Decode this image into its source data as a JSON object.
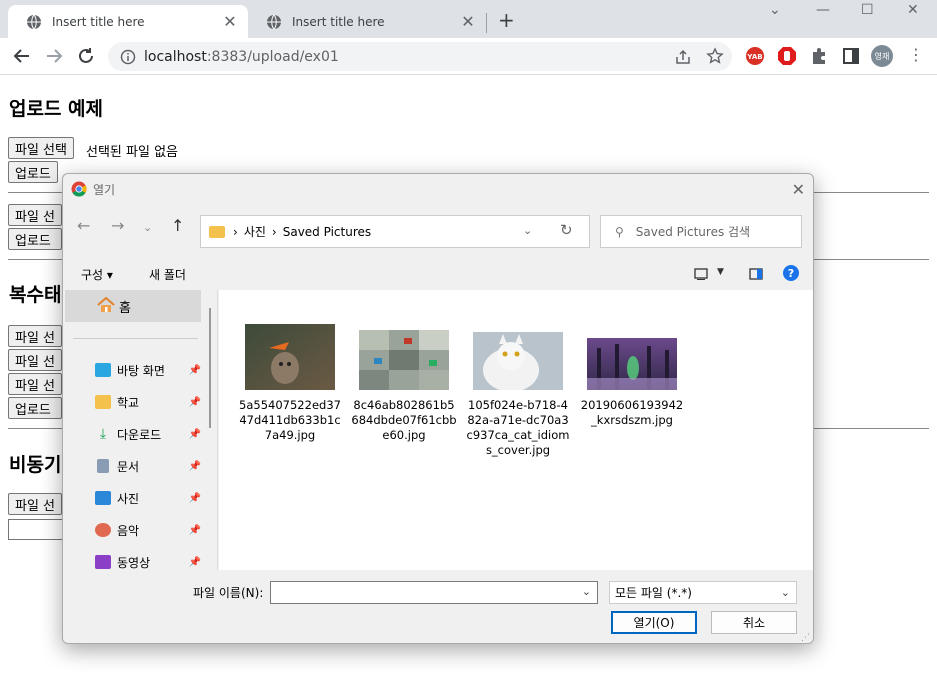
{
  "tabs": [
    {
      "title": "Insert title here",
      "active": true
    },
    {
      "title": "Insert title here",
      "active": false
    }
  ],
  "omnibox": {
    "host": "localhost",
    "rest": ":8383/upload/ex01"
  },
  "profile": {
    "initials": "영재"
  },
  "extensions": [
    "yab-icon",
    "adblock-icon",
    "puzzle-icon",
    "sidepanel-icon"
  ],
  "page": {
    "heading1": "업로드 예제",
    "file_button": "파일 선택",
    "no_file": "선택된 파일 없음",
    "upload_button": "업로드",
    "heading2": "복수태",
    "heading3": "비동기",
    "file_button_partial": "파일 선"
  },
  "dialog": {
    "title": "열기",
    "crumbs": [
      "사진",
      "Saved Pictures"
    ],
    "search_placeholder": "Saved Pictures 검색",
    "cmd_organize": "구성 ▾",
    "cmd_new_folder": "새 폴더",
    "help": "?",
    "nav": {
      "home": "홈",
      "items": [
        {
          "label": "바탕 화면",
          "icon": "desktop-icon",
          "color": "#2aa7e0"
        },
        {
          "label": "학교",
          "icon": "folder-icon",
          "color": "#f3c14c"
        },
        {
          "label": "다운로드",
          "icon": "download-icon",
          "color": "#1aa35a"
        },
        {
          "label": "문서",
          "icon": "document-icon",
          "color": "#8a9bb4"
        },
        {
          "label": "사진",
          "icon": "pictures-icon",
          "color": "#2b88d8"
        },
        {
          "label": "음악",
          "icon": "music-icon",
          "color": "#e06a4f"
        },
        {
          "label": "동영상",
          "icon": "video-icon",
          "color": "#8b3fc7"
        }
      ]
    },
    "files": [
      {
        "name": "5a55407522ed3747d411db633b1c7a49.jpg"
      },
      {
        "name": "8c46ab802861b5684dbde07f61cbbe60.jpg"
      },
      {
        "name": "105f024e-b718-482a-a71e-dc70a3c937ca_cat_idioms_cover.jpg"
      },
      {
        "name": "20190606193942_kxrsdszm.jpg"
      }
    ],
    "filename_label": "파일 이름(N):",
    "filename_value": "",
    "filter": "모든 파일 (*.*)",
    "open_button": "열기(O)",
    "cancel_button": "취소"
  }
}
